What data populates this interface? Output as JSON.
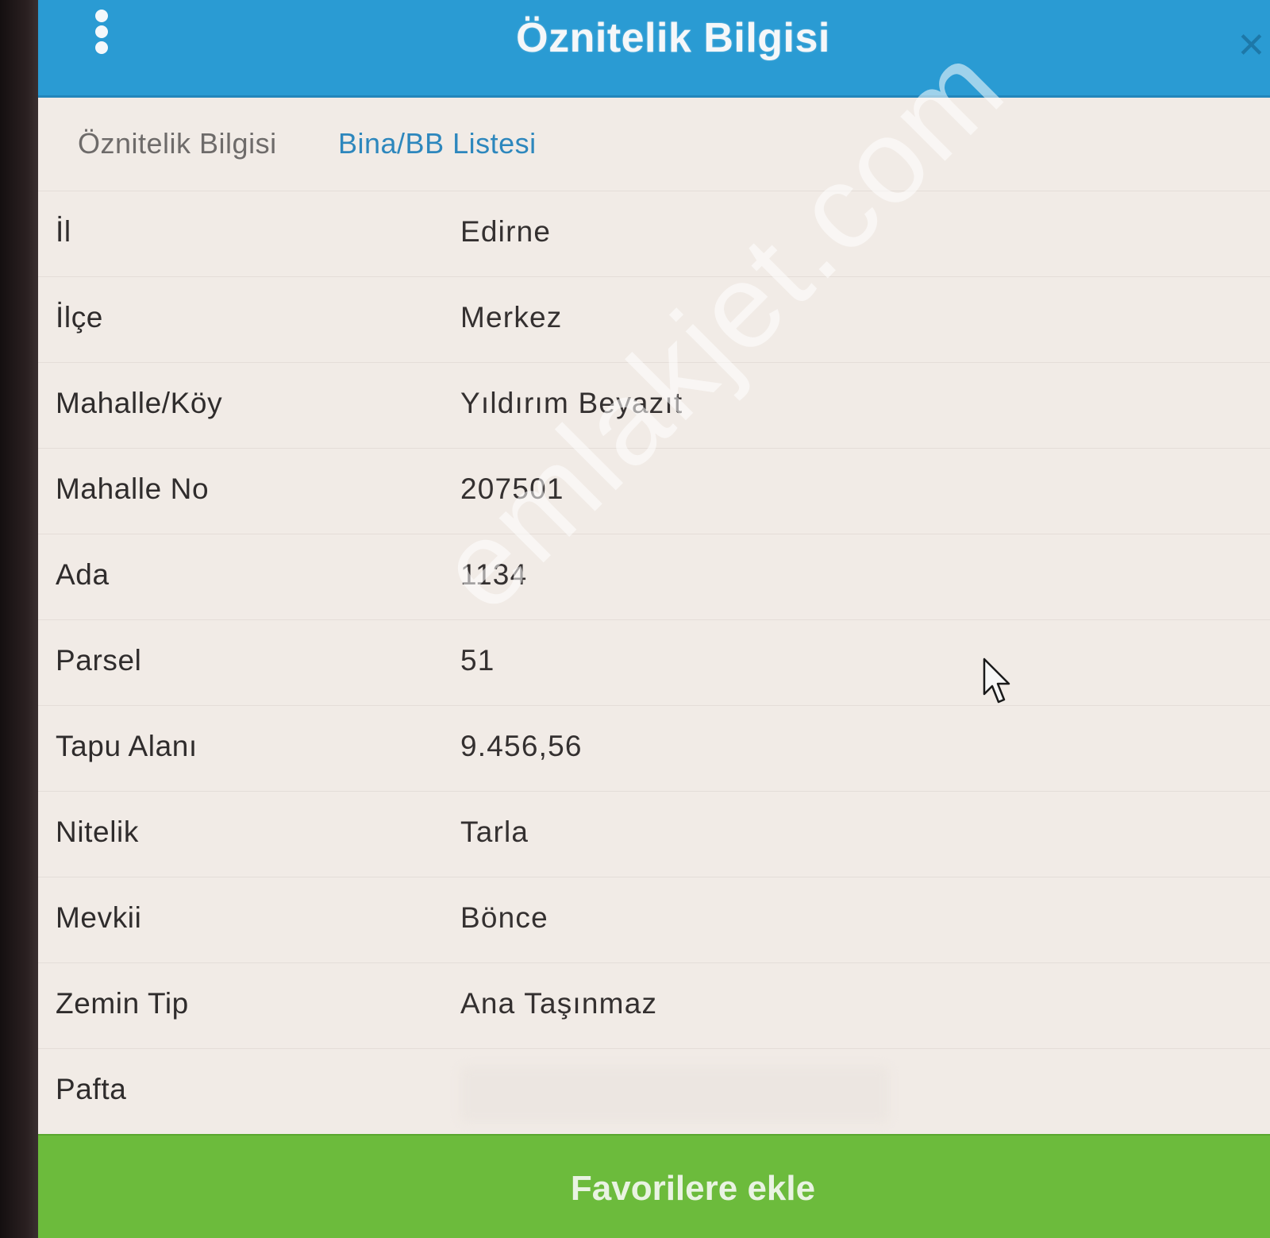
{
  "header": {
    "title": "Öznitelik Bilgisi",
    "menu_icon": "kebab-menu-icon",
    "close_icon": "close-icon",
    "color": "#2a9bd3"
  },
  "tabs": [
    {
      "label": "Öznitelik Bilgisi",
      "active": true
    },
    {
      "label": "Bina/BB Listesi",
      "active": false
    }
  ],
  "attributes": [
    {
      "label": "İl",
      "value": "Edirne"
    },
    {
      "label": "İlçe",
      "value": "Merkez"
    },
    {
      "label": "Mahalle/Köy",
      "value": "Yıldırım Beyazıt"
    },
    {
      "label": "Mahalle No",
      "value": "207501"
    },
    {
      "label": "Ada",
      "value": "1134"
    },
    {
      "label": "Parsel",
      "value": "51"
    },
    {
      "label": "Tapu Alanı",
      "value": "9.456,56"
    },
    {
      "label": "Nitelik",
      "value": "Tarla"
    },
    {
      "label": "Mevkii",
      "value": "Bönce"
    },
    {
      "label": "Zemin Tip",
      "value": "Ana Taşınmaz"
    },
    {
      "label": "Pafta",
      "value": null
    }
  ],
  "footer": {
    "button_label": "Favorilere ekle",
    "color": "#6cbb3c"
  },
  "watermark": "emlakjet.com"
}
